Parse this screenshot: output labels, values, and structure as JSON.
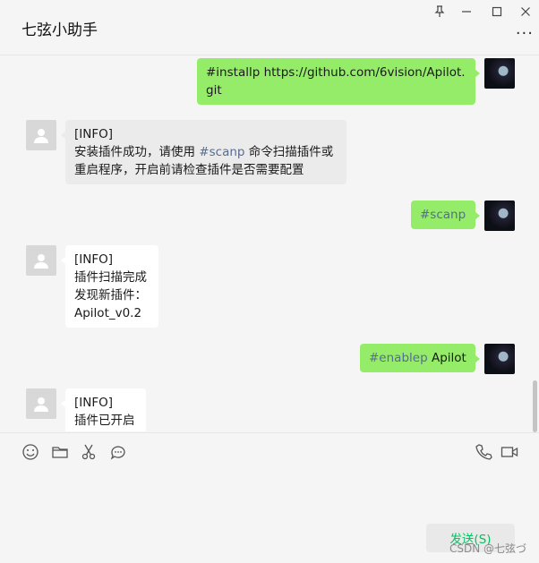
{
  "window": {
    "title": "七弦小助手",
    "controls": [
      "pin-icon",
      "minimize-icon",
      "maximize-icon",
      "close-icon"
    ],
    "more_label": "···"
  },
  "messages": [
    {
      "from": "self",
      "lines": [
        "#installp https://github.com/6vision/Apilot.",
        "git"
      ]
    },
    {
      "from": "bot",
      "lines": [
        "[INFO]",
        "安装插件成功，请使用",
        "#scanp",
        "命令扫描插件或",
        "重启程序，开启前请检查插件是否需要配置"
      ]
    },
    {
      "from": "self",
      "text": "#scanp"
    },
    {
      "from": "bot",
      "lines": [
        "[INFO]",
        "插件扫描完成",
        "发现新插件：",
        "Apilot_v0.2"
      ]
    },
    {
      "from": "self",
      "prefix": "#enablep",
      "suffix": "Apilot"
    },
    {
      "from": "bot",
      "lines": [
        "[INFO]",
        "插件已开启"
      ]
    }
  ],
  "toolbar": {
    "icons": [
      "emoji-icon",
      "folder-icon",
      "scissors-icon",
      "chat-bubble-icon",
      "phone-icon",
      "video-icon"
    ]
  },
  "send": {
    "label": "发送(S)"
  },
  "watermark": "CSDN @七弦づ",
  "colors": {
    "self_bubble": "#95ec69",
    "bot_bubble": "#ebebeb",
    "send_text": "#07c160",
    "link": "#576b95"
  }
}
